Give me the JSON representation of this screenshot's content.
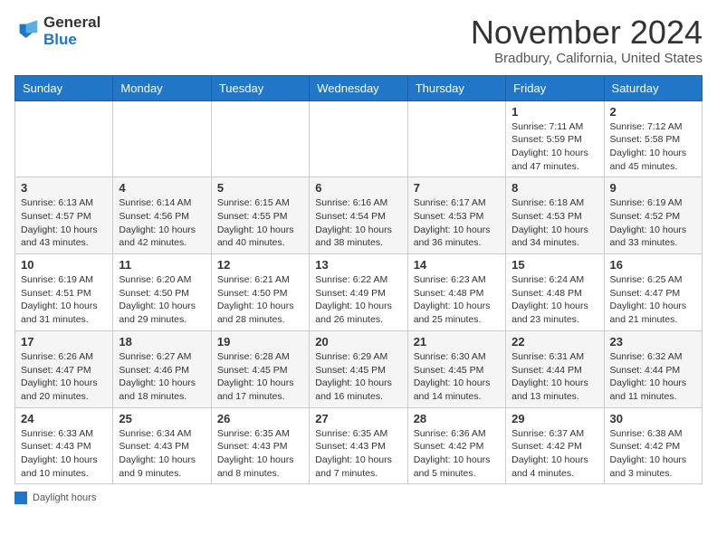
{
  "header": {
    "logo_general": "General",
    "logo_blue": "Blue",
    "month": "November 2024",
    "location": "Bradbury, California, United States"
  },
  "days_of_week": [
    "Sunday",
    "Monday",
    "Tuesday",
    "Wednesday",
    "Thursday",
    "Friday",
    "Saturday"
  ],
  "weeks": [
    [
      {
        "day": "",
        "info": ""
      },
      {
        "day": "",
        "info": ""
      },
      {
        "day": "",
        "info": ""
      },
      {
        "day": "",
        "info": ""
      },
      {
        "day": "",
        "info": ""
      },
      {
        "day": "1",
        "info": "Sunrise: 7:11 AM\nSunset: 5:59 PM\nDaylight: 10 hours\nand 47 minutes."
      },
      {
        "day": "2",
        "info": "Sunrise: 7:12 AM\nSunset: 5:58 PM\nDaylight: 10 hours\nand 45 minutes."
      }
    ],
    [
      {
        "day": "3",
        "info": "Sunrise: 6:13 AM\nSunset: 4:57 PM\nDaylight: 10 hours\nand 43 minutes."
      },
      {
        "day": "4",
        "info": "Sunrise: 6:14 AM\nSunset: 4:56 PM\nDaylight: 10 hours\nand 42 minutes."
      },
      {
        "day": "5",
        "info": "Sunrise: 6:15 AM\nSunset: 4:55 PM\nDaylight: 10 hours\nand 40 minutes."
      },
      {
        "day": "6",
        "info": "Sunrise: 6:16 AM\nSunset: 4:54 PM\nDaylight: 10 hours\nand 38 minutes."
      },
      {
        "day": "7",
        "info": "Sunrise: 6:17 AM\nSunset: 4:53 PM\nDaylight: 10 hours\nand 36 minutes."
      },
      {
        "day": "8",
        "info": "Sunrise: 6:18 AM\nSunset: 4:53 PM\nDaylight: 10 hours\nand 34 minutes."
      },
      {
        "day": "9",
        "info": "Sunrise: 6:19 AM\nSunset: 4:52 PM\nDaylight: 10 hours\nand 33 minutes."
      }
    ],
    [
      {
        "day": "10",
        "info": "Sunrise: 6:19 AM\nSunset: 4:51 PM\nDaylight: 10 hours\nand 31 minutes."
      },
      {
        "day": "11",
        "info": "Sunrise: 6:20 AM\nSunset: 4:50 PM\nDaylight: 10 hours\nand 29 minutes."
      },
      {
        "day": "12",
        "info": "Sunrise: 6:21 AM\nSunset: 4:50 PM\nDaylight: 10 hours\nand 28 minutes."
      },
      {
        "day": "13",
        "info": "Sunrise: 6:22 AM\nSunset: 4:49 PM\nDaylight: 10 hours\nand 26 minutes."
      },
      {
        "day": "14",
        "info": "Sunrise: 6:23 AM\nSunset: 4:48 PM\nDaylight: 10 hours\nand 25 minutes."
      },
      {
        "day": "15",
        "info": "Sunrise: 6:24 AM\nSunset: 4:48 PM\nDaylight: 10 hours\nand 23 minutes."
      },
      {
        "day": "16",
        "info": "Sunrise: 6:25 AM\nSunset: 4:47 PM\nDaylight: 10 hours\nand 21 minutes."
      }
    ],
    [
      {
        "day": "17",
        "info": "Sunrise: 6:26 AM\nSunset: 4:47 PM\nDaylight: 10 hours\nand 20 minutes."
      },
      {
        "day": "18",
        "info": "Sunrise: 6:27 AM\nSunset: 4:46 PM\nDaylight: 10 hours\nand 18 minutes."
      },
      {
        "day": "19",
        "info": "Sunrise: 6:28 AM\nSunset: 4:45 PM\nDaylight: 10 hours\nand 17 minutes."
      },
      {
        "day": "20",
        "info": "Sunrise: 6:29 AM\nSunset: 4:45 PM\nDaylight: 10 hours\nand 16 minutes."
      },
      {
        "day": "21",
        "info": "Sunrise: 6:30 AM\nSunset: 4:45 PM\nDaylight: 10 hours\nand 14 minutes."
      },
      {
        "day": "22",
        "info": "Sunrise: 6:31 AM\nSunset: 4:44 PM\nDaylight: 10 hours\nand 13 minutes."
      },
      {
        "day": "23",
        "info": "Sunrise: 6:32 AM\nSunset: 4:44 PM\nDaylight: 10 hours\nand 11 minutes."
      }
    ],
    [
      {
        "day": "24",
        "info": "Sunrise: 6:33 AM\nSunset: 4:43 PM\nDaylight: 10 hours\nand 10 minutes."
      },
      {
        "day": "25",
        "info": "Sunrise: 6:34 AM\nSunset: 4:43 PM\nDaylight: 10 hours\nand 9 minutes."
      },
      {
        "day": "26",
        "info": "Sunrise: 6:35 AM\nSunset: 4:43 PM\nDaylight: 10 hours\nand 8 minutes."
      },
      {
        "day": "27",
        "info": "Sunrise: 6:35 AM\nSunset: 4:43 PM\nDaylight: 10 hours\nand 7 minutes."
      },
      {
        "day": "28",
        "info": "Sunrise: 6:36 AM\nSunset: 4:42 PM\nDaylight: 10 hours\nand 5 minutes."
      },
      {
        "day": "29",
        "info": "Sunrise: 6:37 AM\nSunset: 4:42 PM\nDaylight: 10 hours\nand 4 minutes."
      },
      {
        "day": "30",
        "info": "Sunrise: 6:38 AM\nSunset: 4:42 PM\nDaylight: 10 hours\nand 3 minutes."
      }
    ]
  ],
  "legend": {
    "label": "Daylight hours"
  }
}
